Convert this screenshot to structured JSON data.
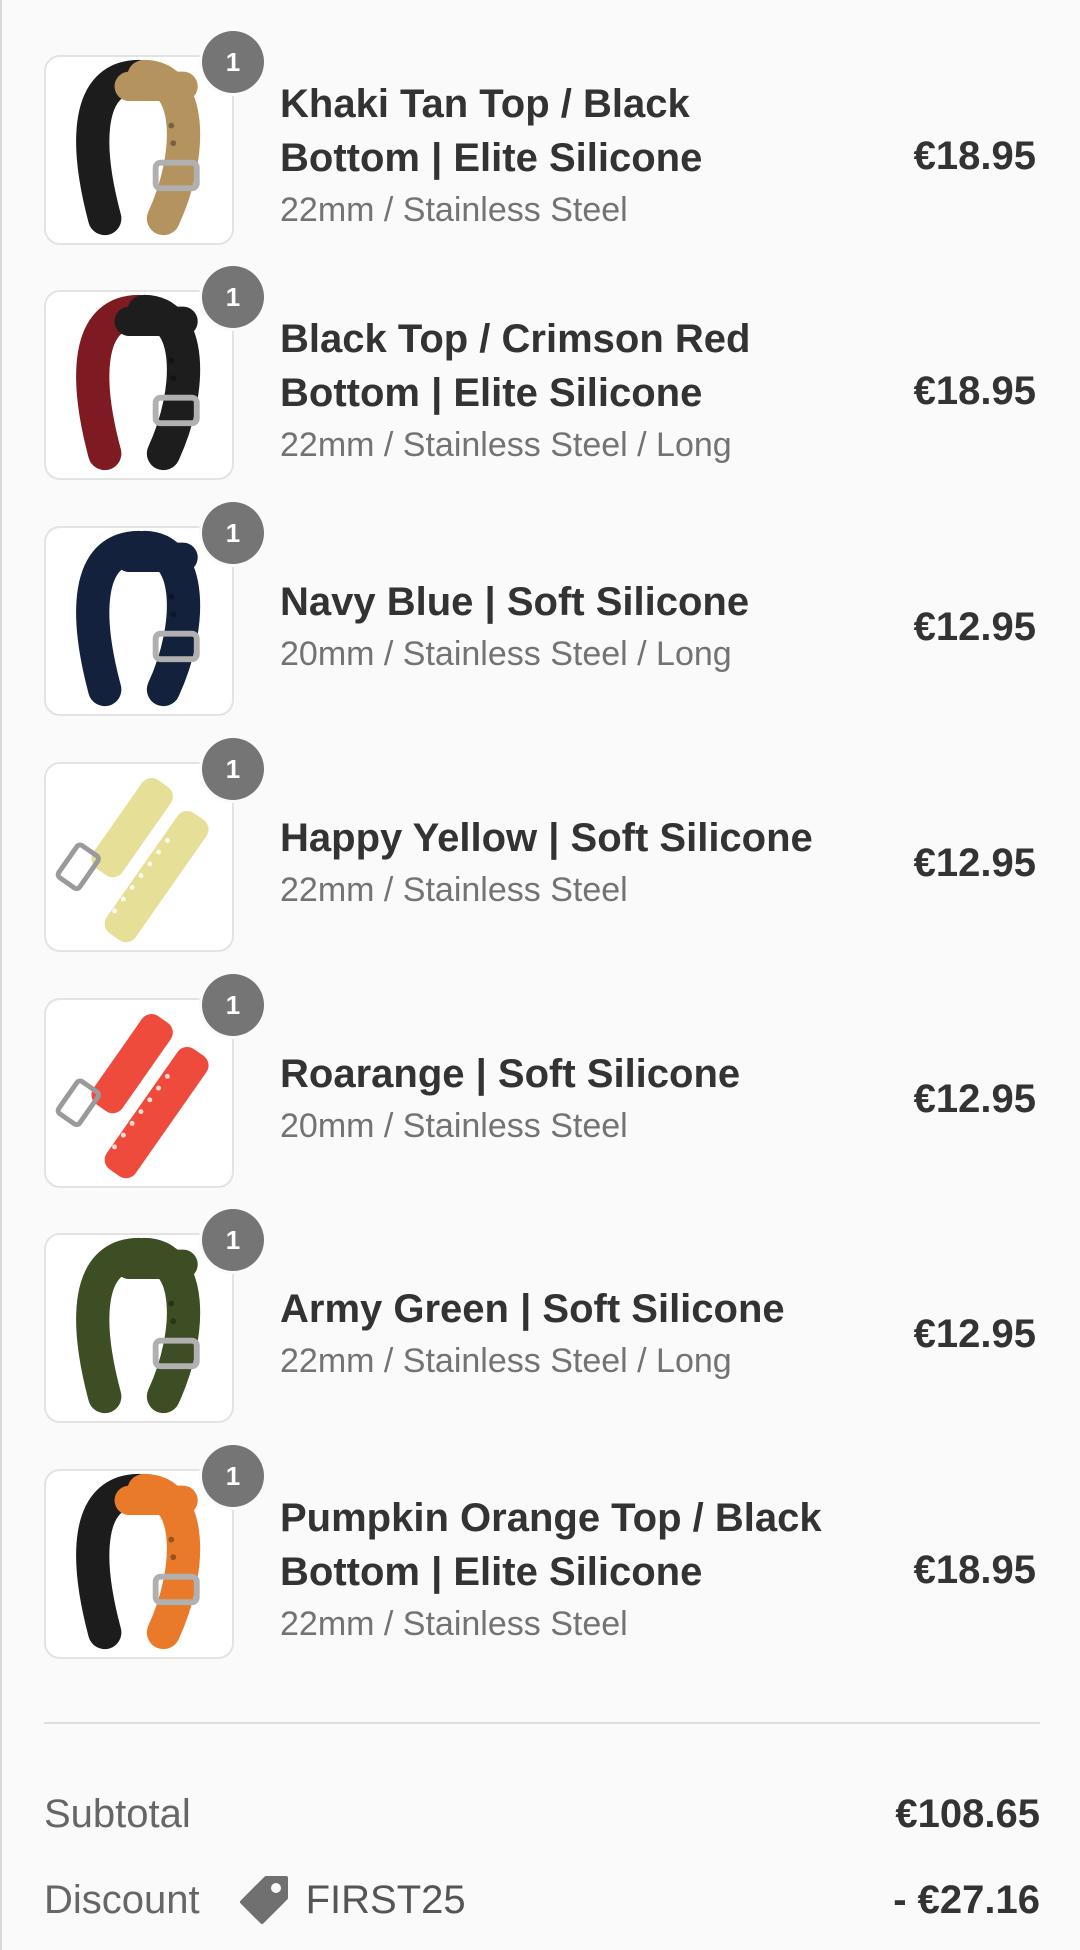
{
  "cart": {
    "items": [
      {
        "title": "Khaki Tan Top / Black Bottom | Elite Silicone",
        "variant": "22mm / Stainless Steel",
        "price": "€18.95",
        "quantity": "1",
        "color_top": "#b5935f",
        "color_bottom": "#1c1c1c"
      },
      {
        "title": "Black Top / Crimson Red Bottom | Elite Silicone",
        "variant": "22mm / Stainless Steel / Long",
        "price": "€18.95",
        "quantity": "1",
        "color_top": "#1d1d1d",
        "color_bottom": "#7e1a22"
      },
      {
        "title": "Navy Blue | Soft Silicone",
        "variant": "20mm / Stainless Steel / Long",
        "price": "€12.95",
        "quantity": "1",
        "color_top": "#14213d",
        "color_bottom": "#14213d"
      },
      {
        "title": "Happy Yellow | Soft Silicone",
        "variant": "22mm / Stainless Steel",
        "price": "€12.95",
        "quantity": "1",
        "color_top": "#e6df98",
        "color_bottom": "#e6df98"
      },
      {
        "title": "Roarange | Soft Silicone",
        "variant": "20mm / Stainless Steel",
        "price": "€12.95",
        "quantity": "1",
        "color_top": "#ef4b3c",
        "color_bottom": "#ef4b3c"
      },
      {
        "title": "Army Green | Soft Silicone",
        "variant": "22mm / Stainless Steel / Long",
        "price": "€12.95",
        "quantity": "1",
        "color_top": "#3d4d24",
        "color_bottom": "#3d4d24"
      },
      {
        "title": "Pumpkin Orange Top / Black Bottom | Elite Silicone",
        "variant": "22mm / Stainless Steel",
        "price": "€18.95",
        "quantity": "1",
        "color_top": "#e87a2a",
        "color_bottom": "#1c1c1c"
      }
    ]
  },
  "summary": {
    "subtotal_label": "Subtotal",
    "subtotal_value": "€108.65",
    "discount_label": "Discount",
    "discount_code": "FIRST25",
    "discount_value": "- €27.16",
    "discount_icon": "tag-icon"
  },
  "colors": {
    "badge": "#757575",
    "text": "#333333",
    "muted": "#737373"
  }
}
